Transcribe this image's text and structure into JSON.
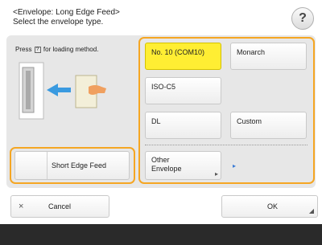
{
  "header": {
    "line1": "<Envelope: Long Edge Feed>",
    "line2": "Select the envelope type."
  },
  "help": {
    "label": "?"
  },
  "instruction": {
    "before": "Press",
    "icon_label": "?",
    "after": "for loading method."
  },
  "short_edge_feed": {
    "label": "Short Edge Feed"
  },
  "envelopes": {
    "no10": "No. 10 (COM10)",
    "monarch": "Monarch",
    "isoc5": "ISO-C5",
    "dl": "DL",
    "custom": "Custom",
    "other_line1": "Other",
    "other_line2": "Envelope",
    "selected": "No. 10 (COM10)"
  },
  "footer": {
    "cancel_icon": "×",
    "cancel_label": "Cancel",
    "ok_label": "OK"
  },
  "colors": {
    "selected": "#ffee33",
    "highlight": "#f5a623",
    "arrow": "#3a7bd5"
  },
  "icons": {
    "help": "question-mark-icon",
    "cancel": "close-icon",
    "corner": "corner-arrow-icon",
    "next": "arrow-right-icon"
  }
}
